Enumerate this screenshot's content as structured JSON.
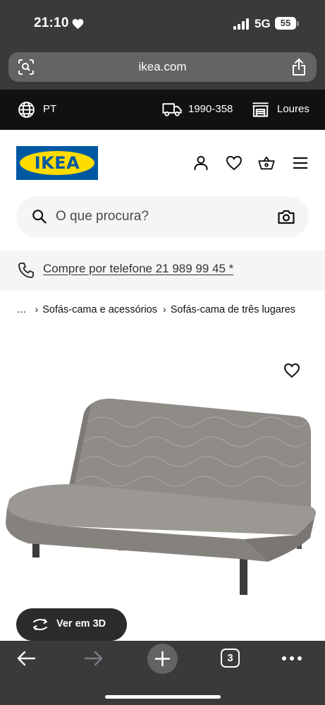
{
  "status_bar": {
    "time": "21:10",
    "network": "5G",
    "battery": "55"
  },
  "browser": {
    "url": "ikea.com",
    "open_tabs": "3"
  },
  "utility_bar": {
    "language": "PT",
    "postal_code": "1990-358",
    "store": "Loures"
  },
  "header": {
    "logo_text": "IKEA"
  },
  "search": {
    "placeholder": "O que procura?"
  },
  "phone_bar": {
    "text": "Compre por telefone 21 989 99 45 *"
  },
  "breadcrumb": {
    "ellipsis": "…",
    "items": [
      {
        "label": "Sofás-cama e acessórios"
      },
      {
        "label": "Sofás-cama de três lugares"
      }
    ]
  },
  "product": {
    "view_3d_label": "Ver em 3D"
  },
  "colors": {
    "ikea_blue": "#0058a3",
    "ikea_yellow": "#ffdb00",
    "browser_chrome": "#3a3a3c",
    "utility_bar": "#111111",
    "sofa_fabric": "#8f8c88"
  }
}
